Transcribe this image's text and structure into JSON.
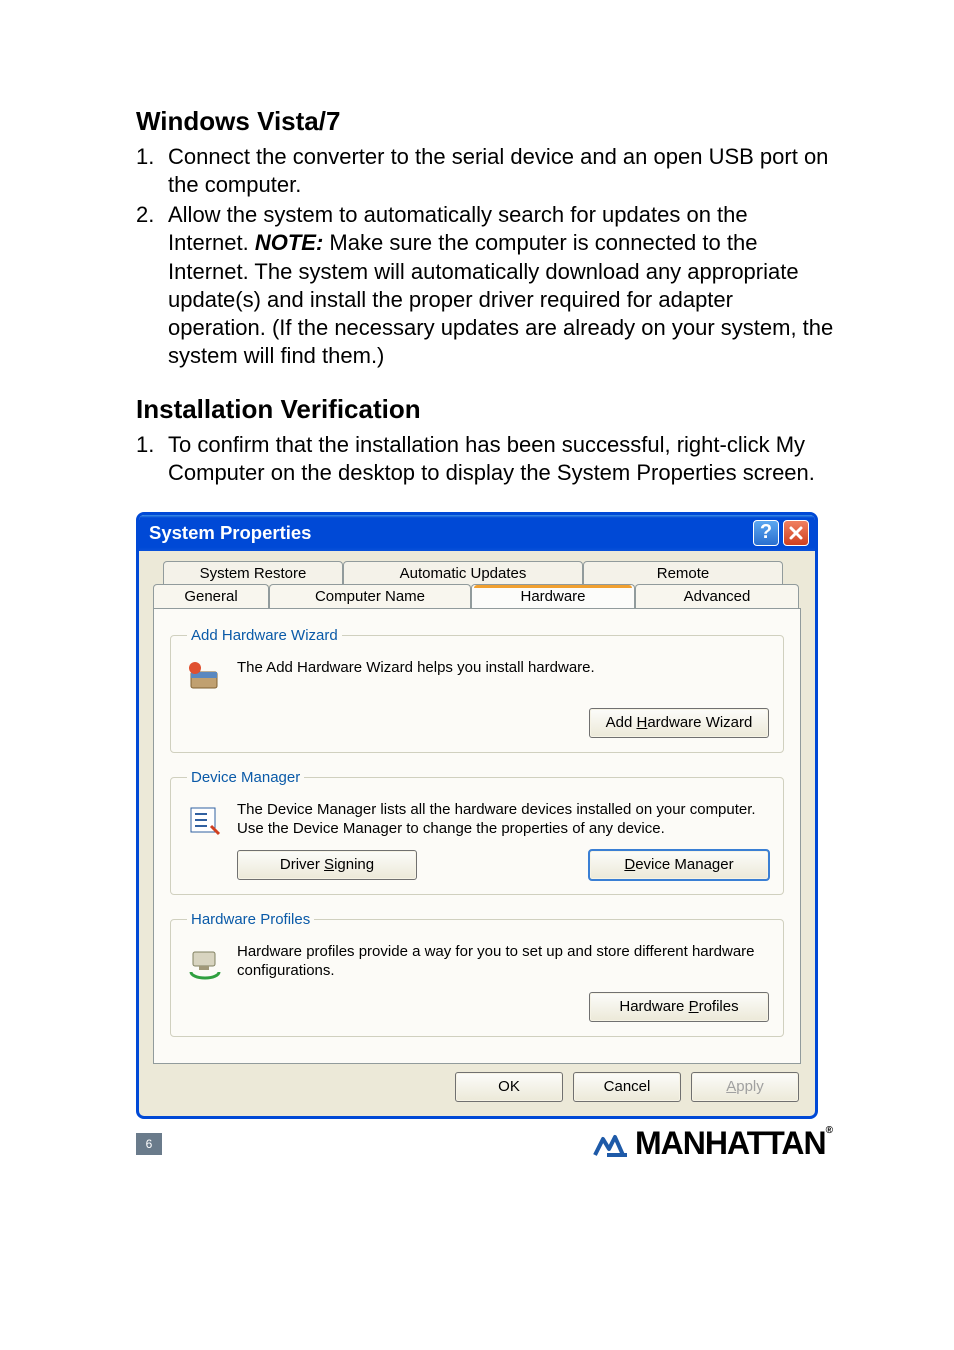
{
  "sections": {
    "vista": {
      "heading": "Windows Vista/7",
      "steps": [
        {
          "num": "1.",
          "body": "Connect the converter to the serial device and an open USB port on the computer."
        },
        {
          "num": "2.",
          "body_pre": "Allow the system to automatically search for updates on the Internet. ",
          "note_label": "NOTE:",
          "body_post": " Make sure the computer is connected to the Internet. The system will automatically download any appropriate update(s) and install the proper driver required for adapter operation. (If the necessary updates are already on your system, the system will find them.)"
        }
      ]
    },
    "verify": {
      "heading": "Installation Verification",
      "steps": [
        {
          "num": "1.",
          "body": "To confirm that the installation has been successful, right-click My Computer on the desktop to display the System Properties screen."
        }
      ]
    }
  },
  "dialog": {
    "title": "System Properties",
    "tabs_back": [
      "System Restore",
      "Automatic Updates",
      "Remote"
    ],
    "tabs_front": [
      "General",
      "Computer Name",
      "Hardware",
      "Advanced"
    ],
    "active_tab": "Hardware",
    "groups": {
      "addhw": {
        "legend": "Add Hardware Wizard",
        "text": "The Add Hardware Wizard helps you install hardware.",
        "btn": "Add Hardware Wizard",
        "btn_underline_index": 4
      },
      "devmgr": {
        "legend": "Device Manager",
        "text": "The Device Manager lists all the hardware devices installed on your computer. Use the Device Manager to change the properties of any device.",
        "btn1": "Driver Signing",
        "btn2": "Device Manager"
      },
      "hwprof": {
        "legend": "Hardware Profiles",
        "text": "Hardware profiles provide a way for you to set up and store different hardware configurations.",
        "btn": "Hardware Profiles"
      }
    },
    "footer_buttons": {
      "ok": "OK",
      "cancel": "Cancel",
      "apply": "Apply"
    }
  },
  "footer": {
    "page": "6",
    "brand": "MANHATTAN"
  }
}
